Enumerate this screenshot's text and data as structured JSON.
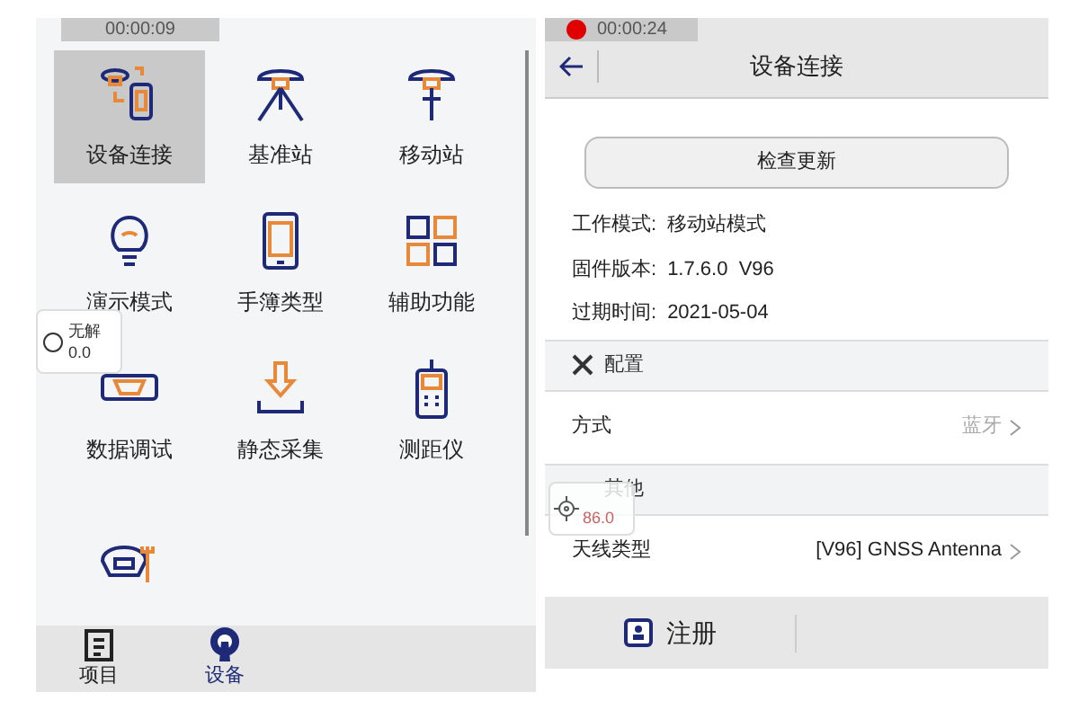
{
  "left_screen": {
    "timer": "00:00:09",
    "items": [
      {
        "label": "设备连接",
        "kind": "link",
        "selected": true
      },
      {
        "label": "基准站",
        "kind": "tripod",
        "selected": false
      },
      {
        "label": "移动站",
        "kind": "pole",
        "selected": false
      },
      {
        "label": "演示模式",
        "kind": "bulb",
        "selected": false
      },
      {
        "label": "手簿类型",
        "kind": "phone",
        "selected": false
      },
      {
        "label": "辅助功能",
        "kind": "grid",
        "selected": false
      },
      {
        "label": "数据调试",
        "kind": "port",
        "selected": false
      },
      {
        "label": "静态采集",
        "kind": "download",
        "selected": false
      },
      {
        "label": "测距仪",
        "kind": "handheld",
        "selected": false
      },
      {
        "kind": "wrench",
        "selected": false
      }
    ],
    "status_widget": {
      "title": "无解",
      "value": "0.0"
    },
    "bottom_tabs": [
      {
        "label": "项目",
        "kind": "clipboard",
        "selected": false
      },
      {
        "label": "设备",
        "kind": "antenna",
        "selected": true
      }
    ]
  },
  "right_screen": {
    "timer": "00:00:24",
    "title": "设备连接",
    "check_update_button": "检查更新",
    "info": [
      {
        "label": "工作模式:",
        "value": "移动站模式"
      },
      {
        "label": "固件版本:",
        "value": "1.7.6.0  V96"
      },
      {
        "label": "过期时间:",
        "value": "2021-05-04"
      }
    ],
    "sections": [
      {
        "title": "配置",
        "rows": [
          {
            "label": "方式",
            "value": "蓝牙",
            "muted": true
          }
        ]
      },
      {
        "title": "其他",
        "rows": [
          {
            "label": "天线类型",
            "value": "[V96] GNSS Antenna",
            "muted": false
          }
        ]
      }
    ],
    "overlay_widget": {
      "value": "86.0"
    },
    "register_button": "注册"
  }
}
